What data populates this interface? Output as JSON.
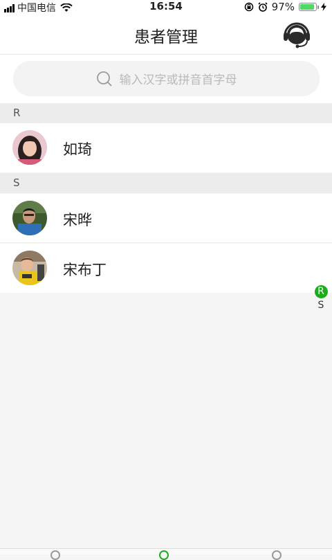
{
  "status_bar": {
    "carrier": "中国电信",
    "time": "16:54",
    "battery": "97%",
    "battery_level": 0.97
  },
  "header": {
    "title": "患者管理",
    "service_icon": "customer-service-headset-icon"
  },
  "search": {
    "placeholder": "输入汉字或拼音首字母"
  },
  "sections": [
    {
      "letter": "R",
      "patients": [
        {
          "name": "如琦"
        }
      ]
    },
    {
      "letter": "S",
      "patients": [
        {
          "name": "宋晔"
        },
        {
          "name": "宋布丁"
        }
      ]
    }
  ],
  "index_bar": {
    "items": [
      "R",
      "S"
    ],
    "active": "R"
  },
  "colors": {
    "accent": "#1aad19",
    "battery": "#4cd964"
  }
}
